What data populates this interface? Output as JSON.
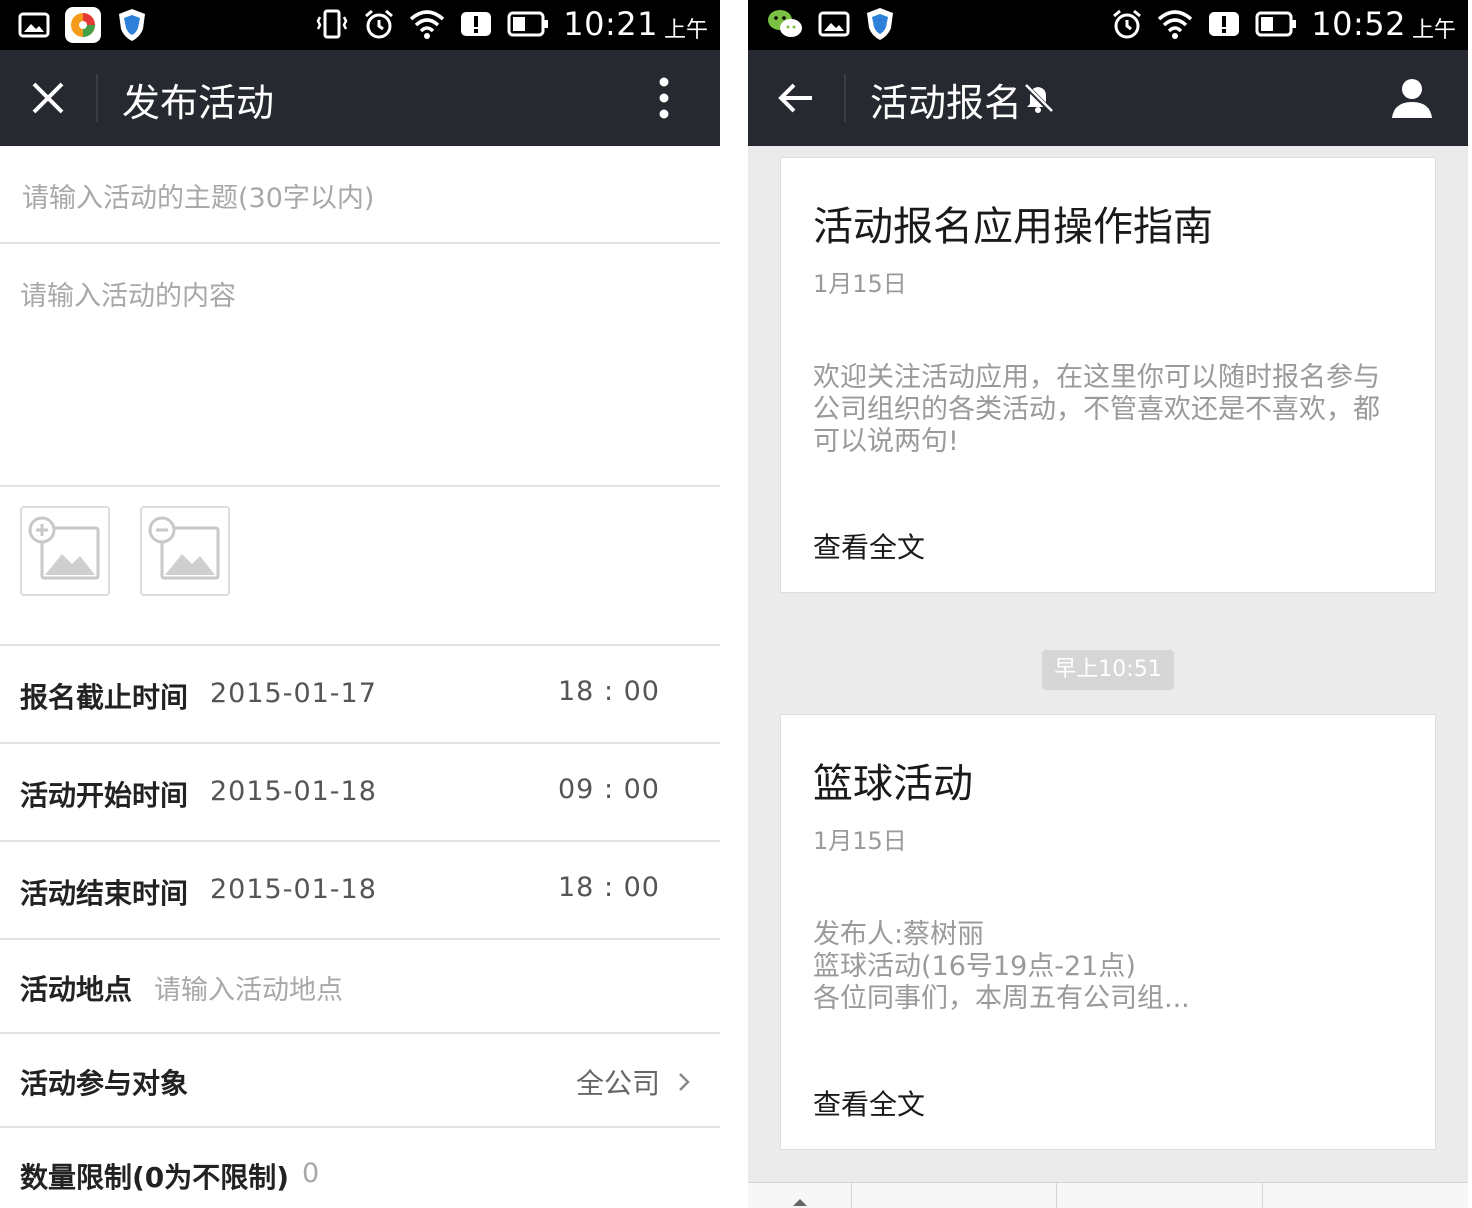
{
  "left": {
    "status": {
      "time": "10:21",
      "ampm": "上午"
    },
    "header": {
      "title": "发布活动"
    },
    "form": {
      "subject_placeholder": "请输入活动的主题(30字以内)",
      "content_placeholder": "请输入活动的内容",
      "deadline": {
        "label": "报名截止时间",
        "date": "2015-01-17",
        "time": "18 : 00"
      },
      "start": {
        "label": "活动开始时间",
        "date": "2015-01-18",
        "time": "09 : 00"
      },
      "end": {
        "label": "活动结束时间",
        "date": "2015-01-18",
        "time": "18 : 00"
      },
      "location": {
        "label": "活动地点",
        "placeholder": "请输入活动地点"
      },
      "audience": {
        "label": "活动参与对象",
        "value": "全公司"
      },
      "limit": {
        "label": "数量限制(0为不限制)",
        "value": "0"
      }
    }
  },
  "right": {
    "status": {
      "time": "10:52",
      "ampm": "上午"
    },
    "header": {
      "title": "活动报名"
    },
    "cards": [
      {
        "title": "活动报名应用操作指南",
        "date": "1月15日",
        "desc": [
          "欢迎关注活动应用，在这里你可以随时报名参与",
          "公司组织的各类活动，不管喜欢还是不喜欢，都",
          "可以说两句!"
        ],
        "more": "查看全文"
      },
      {
        "title": "篮球活动",
        "date": "1月15日",
        "desc": [
          "发布人:蔡树丽",
          "篮球活动(16号19点-21点)",
          "各位同事们，本周五有公司组..."
        ],
        "more": "查看全文"
      }
    ],
    "time_chip": "早上10:51"
  },
  "colors": {
    "titlebar": "#262a30",
    "status_bar": "#000000",
    "placeholder": "#a8a8a8",
    "right_background": "#ebebeb"
  },
  "icons": {
    "left_status": [
      "gallery-icon",
      "app-icon",
      "shield-icon",
      "vibrate-icon",
      "alarm-icon",
      "wifi-icon",
      "alert-icon",
      "battery-icon"
    ],
    "right_status": [
      "wechat-icon",
      "gallery-icon",
      "shield-icon",
      "alarm-icon",
      "wifi-icon",
      "alert-icon",
      "battery-icon"
    ],
    "left_header": [
      "close-icon",
      "more-vertical-icon"
    ],
    "right_header": [
      "back-arrow-icon",
      "mute-icon",
      "person-icon"
    ],
    "form": [
      "add-image-icon",
      "remove-image-icon",
      "chevron-right-icon"
    ]
  }
}
